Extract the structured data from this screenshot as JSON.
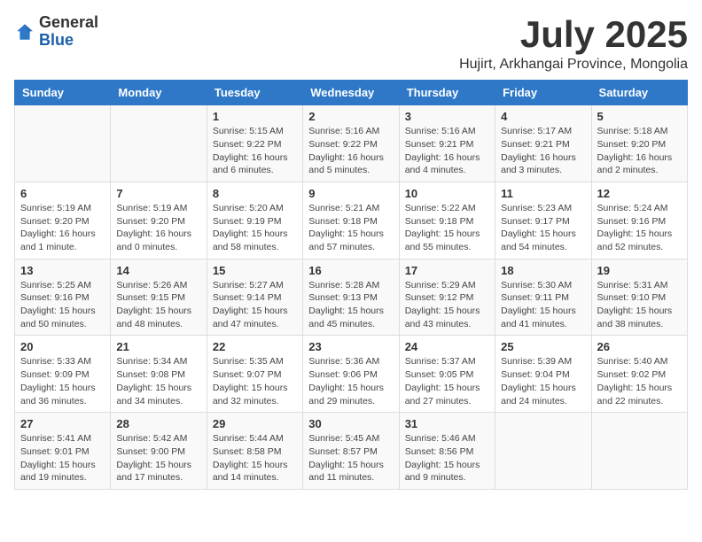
{
  "logo": {
    "general": "General",
    "blue": "Blue"
  },
  "title": "July 2025",
  "subtitle": "Hujirt, Arkhangai Province, Mongolia",
  "weekdays": [
    "Sunday",
    "Monday",
    "Tuesday",
    "Wednesday",
    "Thursday",
    "Friday",
    "Saturday"
  ],
  "weeks": [
    [
      null,
      null,
      {
        "day": 1,
        "sunrise": "Sunrise: 5:15 AM",
        "sunset": "Sunset: 9:22 PM",
        "daylight": "Daylight: 16 hours and 6 minutes."
      },
      {
        "day": 2,
        "sunrise": "Sunrise: 5:16 AM",
        "sunset": "Sunset: 9:22 PM",
        "daylight": "Daylight: 16 hours and 5 minutes."
      },
      {
        "day": 3,
        "sunrise": "Sunrise: 5:16 AM",
        "sunset": "Sunset: 9:21 PM",
        "daylight": "Daylight: 16 hours and 4 minutes."
      },
      {
        "day": 4,
        "sunrise": "Sunrise: 5:17 AM",
        "sunset": "Sunset: 9:21 PM",
        "daylight": "Daylight: 16 hours and 3 minutes."
      },
      {
        "day": 5,
        "sunrise": "Sunrise: 5:18 AM",
        "sunset": "Sunset: 9:20 PM",
        "daylight": "Daylight: 16 hours and 2 minutes."
      }
    ],
    [
      {
        "day": 6,
        "sunrise": "Sunrise: 5:19 AM",
        "sunset": "Sunset: 9:20 PM",
        "daylight": "Daylight: 16 hours and 1 minute."
      },
      {
        "day": 7,
        "sunrise": "Sunrise: 5:19 AM",
        "sunset": "Sunset: 9:20 PM",
        "daylight": "Daylight: 16 hours and 0 minutes."
      },
      {
        "day": 8,
        "sunrise": "Sunrise: 5:20 AM",
        "sunset": "Sunset: 9:19 PM",
        "daylight": "Daylight: 15 hours and 58 minutes."
      },
      {
        "day": 9,
        "sunrise": "Sunrise: 5:21 AM",
        "sunset": "Sunset: 9:18 PM",
        "daylight": "Daylight: 15 hours and 57 minutes."
      },
      {
        "day": 10,
        "sunrise": "Sunrise: 5:22 AM",
        "sunset": "Sunset: 9:18 PM",
        "daylight": "Daylight: 15 hours and 55 minutes."
      },
      {
        "day": 11,
        "sunrise": "Sunrise: 5:23 AM",
        "sunset": "Sunset: 9:17 PM",
        "daylight": "Daylight: 15 hours and 54 minutes."
      },
      {
        "day": 12,
        "sunrise": "Sunrise: 5:24 AM",
        "sunset": "Sunset: 9:16 PM",
        "daylight": "Daylight: 15 hours and 52 minutes."
      }
    ],
    [
      {
        "day": 13,
        "sunrise": "Sunrise: 5:25 AM",
        "sunset": "Sunset: 9:16 PM",
        "daylight": "Daylight: 15 hours and 50 minutes."
      },
      {
        "day": 14,
        "sunrise": "Sunrise: 5:26 AM",
        "sunset": "Sunset: 9:15 PM",
        "daylight": "Daylight: 15 hours and 48 minutes."
      },
      {
        "day": 15,
        "sunrise": "Sunrise: 5:27 AM",
        "sunset": "Sunset: 9:14 PM",
        "daylight": "Daylight: 15 hours and 47 minutes."
      },
      {
        "day": 16,
        "sunrise": "Sunrise: 5:28 AM",
        "sunset": "Sunset: 9:13 PM",
        "daylight": "Daylight: 15 hours and 45 minutes."
      },
      {
        "day": 17,
        "sunrise": "Sunrise: 5:29 AM",
        "sunset": "Sunset: 9:12 PM",
        "daylight": "Daylight: 15 hours and 43 minutes."
      },
      {
        "day": 18,
        "sunrise": "Sunrise: 5:30 AM",
        "sunset": "Sunset: 9:11 PM",
        "daylight": "Daylight: 15 hours and 41 minutes."
      },
      {
        "day": 19,
        "sunrise": "Sunrise: 5:31 AM",
        "sunset": "Sunset: 9:10 PM",
        "daylight": "Daylight: 15 hours and 38 minutes."
      }
    ],
    [
      {
        "day": 20,
        "sunrise": "Sunrise: 5:33 AM",
        "sunset": "Sunset: 9:09 PM",
        "daylight": "Daylight: 15 hours and 36 minutes."
      },
      {
        "day": 21,
        "sunrise": "Sunrise: 5:34 AM",
        "sunset": "Sunset: 9:08 PM",
        "daylight": "Daylight: 15 hours and 34 minutes."
      },
      {
        "day": 22,
        "sunrise": "Sunrise: 5:35 AM",
        "sunset": "Sunset: 9:07 PM",
        "daylight": "Daylight: 15 hours and 32 minutes."
      },
      {
        "day": 23,
        "sunrise": "Sunrise: 5:36 AM",
        "sunset": "Sunset: 9:06 PM",
        "daylight": "Daylight: 15 hours and 29 minutes."
      },
      {
        "day": 24,
        "sunrise": "Sunrise: 5:37 AM",
        "sunset": "Sunset: 9:05 PM",
        "daylight": "Daylight: 15 hours and 27 minutes."
      },
      {
        "day": 25,
        "sunrise": "Sunrise: 5:39 AM",
        "sunset": "Sunset: 9:04 PM",
        "daylight": "Daylight: 15 hours and 24 minutes."
      },
      {
        "day": 26,
        "sunrise": "Sunrise: 5:40 AM",
        "sunset": "Sunset: 9:02 PM",
        "daylight": "Daylight: 15 hours and 22 minutes."
      }
    ],
    [
      {
        "day": 27,
        "sunrise": "Sunrise: 5:41 AM",
        "sunset": "Sunset: 9:01 PM",
        "daylight": "Daylight: 15 hours and 19 minutes."
      },
      {
        "day": 28,
        "sunrise": "Sunrise: 5:42 AM",
        "sunset": "Sunset: 9:00 PM",
        "daylight": "Daylight: 15 hours and 17 minutes."
      },
      {
        "day": 29,
        "sunrise": "Sunrise: 5:44 AM",
        "sunset": "Sunset: 8:58 PM",
        "daylight": "Daylight: 15 hours and 14 minutes."
      },
      {
        "day": 30,
        "sunrise": "Sunrise: 5:45 AM",
        "sunset": "Sunset: 8:57 PM",
        "daylight": "Daylight: 15 hours and 11 minutes."
      },
      {
        "day": 31,
        "sunrise": "Sunrise: 5:46 AM",
        "sunset": "Sunset: 8:56 PM",
        "daylight": "Daylight: 15 hours and 9 minutes."
      },
      null,
      null
    ]
  ]
}
